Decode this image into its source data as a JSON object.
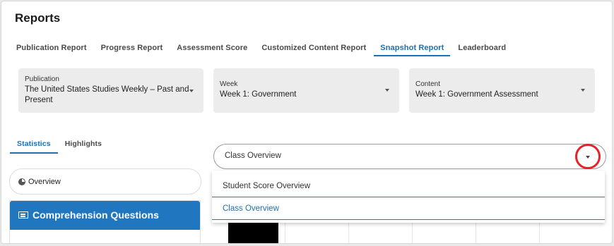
{
  "page": {
    "title": "Reports"
  },
  "report_tabs": [
    {
      "label": "Publication Report",
      "active": false
    },
    {
      "label": "Progress Report",
      "active": false
    },
    {
      "label": "Assessment Score",
      "active": false
    },
    {
      "label": "Customized Content Report",
      "active": false
    },
    {
      "label": "Snapshot Report",
      "active": true
    },
    {
      "label": "Leaderboard",
      "active": false
    }
  ],
  "filters": {
    "publication": {
      "label": "Publication",
      "value_line1": "The United States Studies Weekly – Past and",
      "value_line2": "Present"
    },
    "week": {
      "label": "Week",
      "value": "Week 1: Government"
    },
    "content": {
      "label": "Content",
      "value": "Week 1: Government Assessment"
    }
  },
  "sub_tabs": [
    {
      "label": "Statistics",
      "active": true
    },
    {
      "label": "Highlights",
      "active": false
    }
  ],
  "sidebar": {
    "overview_label": "Overview",
    "section_title": "Comprehension Questions"
  },
  "view_select": {
    "current": "Class Overview",
    "options": [
      {
        "label": "Student Score Overview",
        "selected": false
      },
      {
        "label": "Class Overview",
        "selected": true
      }
    ]
  },
  "colors": {
    "accent": "#1e6fb3",
    "header_blue": "#2176c0",
    "highlight_ring": "#e8202a"
  }
}
